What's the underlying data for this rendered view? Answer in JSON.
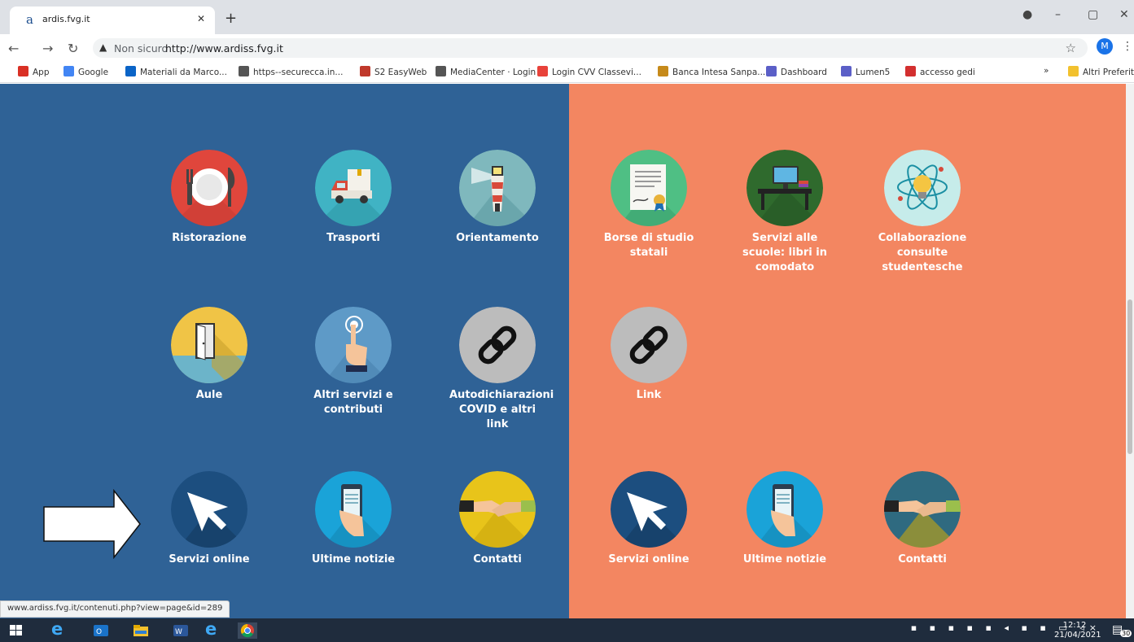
{
  "browser": {
    "tab_title": "ardis.fvg.it",
    "tab_favicon": "a",
    "security": "Non sicuro",
    "url": "http://www.ardiss.fvg.it",
    "profile_initial": "M",
    "bookmarks": [
      {
        "label": "App",
        "icon": "apps-icon",
        "color": "#d93025"
      },
      {
        "label": "Google",
        "icon": "google-icon",
        "color": "#4285f4"
      },
      {
        "label": "Materiali da Marco...",
        "icon": "onedrive-icon",
        "color": "#0a64c7"
      },
      {
        "label": "https--securecca.in...",
        "icon": "globe-icon",
        "color": "#555555"
      },
      {
        "label": "S2 EasyWeb",
        "icon": "s2-icon",
        "color": "#c0392b"
      },
      {
        "label": "MediaCenter · Login",
        "icon": "globe-icon",
        "color": "#555555"
      },
      {
        "label": "Login CVV Classevi...",
        "icon": "cvv-icon",
        "color": "#e8423a"
      },
      {
        "label": "Banca Intesa Sanpa...",
        "icon": "intesa-icon",
        "color": "#c68a1a"
      },
      {
        "label": "Dashboard",
        "icon": "diamond-icon",
        "color": "#5b5fc7"
      },
      {
        "label": "Lumen5",
        "icon": "diamond-icon",
        "color": "#5b5fc7"
      },
      {
        "label": "accesso gedi",
        "icon": "gedi-icon",
        "color": "#d32f2f"
      }
    ],
    "overflow": "»",
    "other_bookmarks": "Altri Preferiti",
    "status_url": "www.ardiss.fvg.it/contenuti.php?view=page&id=289"
  },
  "left_tiles": [
    {
      "name": "ristorazione",
      "label": "Ristorazione",
      "icon": "plate-icon"
    },
    {
      "name": "trasporti",
      "label": "Trasporti",
      "icon": "truck-icon"
    },
    {
      "name": "orientamento",
      "label": "Orientamento",
      "icon": "lighthouse-icon"
    },
    {
      "name": "aule",
      "label": "Aule",
      "icon": "door-icon"
    },
    {
      "name": "altri-servizi",
      "label": "Altri servizi e contributi",
      "icon": "touch-icon"
    },
    {
      "name": "autodichiarazioni",
      "label": "Autodichiarazioni COVID e altri link",
      "icon": "link-icon"
    },
    {
      "name": "servizi-online",
      "label": "Servizi online",
      "icon": "cursor-icon"
    },
    {
      "name": "ultime-notizie",
      "label": "Ultime notizie",
      "icon": "news-icon"
    },
    {
      "name": "contatti",
      "label": "Contatti",
      "icon": "handshake-icon"
    }
  ],
  "right_tiles": [
    {
      "name": "borse-di-studio",
      "label": "Borse di studio statali",
      "icon": "certificate-icon"
    },
    {
      "name": "servizi-scuole",
      "label": "Servizi alle scuole: libri in comodato",
      "icon": "desk-icon"
    },
    {
      "name": "collaborazione",
      "label": "Collaborazione consulte studentesche",
      "icon": "atom-icon"
    },
    {
      "name": "link",
      "label": "Link",
      "icon": "link-icon"
    },
    {
      "name": "servizi-online",
      "label": "Servizi online",
      "icon": "cursor-icon"
    },
    {
      "name": "ultime-notizie",
      "label": "Ultime notizie",
      "icon": "news-icon"
    },
    {
      "name": "contatti",
      "label": "Contatti",
      "icon": "handshake-icon"
    }
  ],
  "taskbar": {
    "time": "12:12",
    "date": "21/04/2021",
    "notifications": "30"
  },
  "colors": {
    "left_bg": "#2f6296",
    "right_bg": "#f38661"
  }
}
